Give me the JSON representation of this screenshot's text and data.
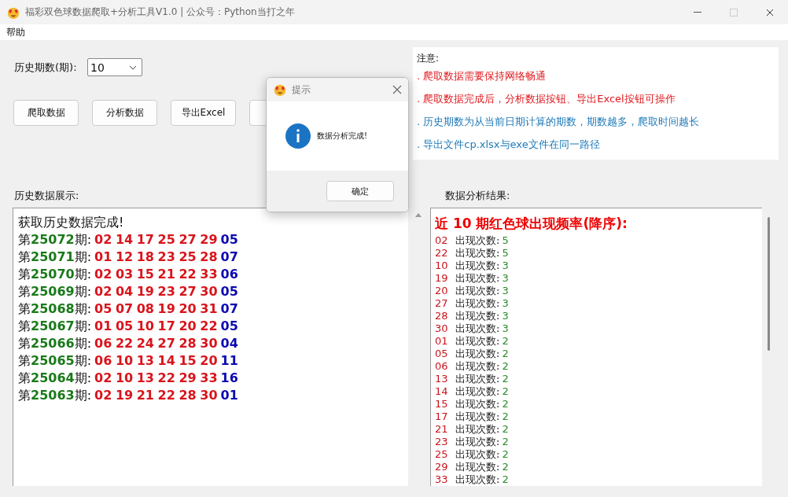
{
  "window": {
    "title": "福彩双色球数据爬取+分析工具V1.0 | 公众号：Python当打之年"
  },
  "menu": [
    "帮助"
  ],
  "period": {
    "label": "历史期数(期):",
    "value": "10"
  },
  "buttons": [
    "爬取数据",
    "分析数据",
    "导出Excel"
  ],
  "notes": {
    "title": "注意:",
    "items": [
      {
        "text": ". 爬取数据需要保持网络畅通",
        "color": "#e0191e"
      },
      {
        "text": ". 爬取数据完成后，分析数据按钮、导出Excel按钮可操作",
        "color": "#e0191e"
      },
      {
        "text": ". 历史期数为从当前日期计算的期数，期数越多，爬取时间越长",
        "color": "#1e7ab8"
      },
      {
        "text": ". 导出文件cp.xlsx与exe文件在同一路径",
        "color": "#1e7ab8"
      }
    ]
  },
  "history": {
    "label": "历史数据展示:",
    "status": "获取历史数据完成!",
    "draws": [
      {
        "prefix": "第",
        "issue": "25072",
        "suffix": "期:",
        "reds": "02 14 17 25 27 29",
        "blue": "05"
      },
      {
        "prefix": "第",
        "issue": "25071",
        "suffix": "期:",
        "reds": "01 12 18 23 25 28",
        "blue": "07"
      },
      {
        "prefix": "第",
        "issue": "25070",
        "suffix": "期:",
        "reds": "02 03 15 21 22 33",
        "blue": "06"
      },
      {
        "prefix": "第",
        "issue": "25069",
        "suffix": "期:",
        "reds": "02 04 19 23 27 30",
        "blue": "05"
      },
      {
        "prefix": "第",
        "issue": "25068",
        "suffix": "期:",
        "reds": "05 07 08 19 20 31",
        "blue": "07"
      },
      {
        "prefix": "第",
        "issue": "25067",
        "suffix": "期:",
        "reds": "01 05 10 17 20 22",
        "blue": "05"
      },
      {
        "prefix": "第",
        "issue": "25066",
        "suffix": "期:",
        "reds": "06 22 24 27 28 30",
        "blue": "04"
      },
      {
        "prefix": "第",
        "issue": "25065",
        "suffix": "期:",
        "reds": "06 10 13 14 15 20",
        "blue": "11"
      },
      {
        "prefix": "第",
        "issue": "25064",
        "suffix": "期:",
        "reds": "02 10 13 22 29 33",
        "blue": "16"
      },
      {
        "prefix": "第",
        "issue": "25063",
        "suffix": "期:",
        "reds": "02 19 21 22 28 30",
        "blue": "01"
      }
    ]
  },
  "analysis": {
    "label": "数据分析结果:",
    "heading": "近 10 期红色球出现频率(降序):",
    "rows": [
      {
        "number": "02",
        "label": "出现次数:",
        "count": "5"
      },
      {
        "number": "22",
        "label": "出现次数:",
        "count": "5"
      },
      {
        "number": "10",
        "label": "出现次数:",
        "count": "3"
      },
      {
        "number": "19",
        "label": "出现次数:",
        "count": "3"
      },
      {
        "number": "20",
        "label": "出现次数:",
        "count": "3"
      },
      {
        "number": "27",
        "label": "出现次数:",
        "count": "3"
      },
      {
        "number": "28",
        "label": "出现次数:",
        "count": "3"
      },
      {
        "number": "30",
        "label": "出现次数:",
        "count": "3"
      },
      {
        "number": "01",
        "label": "出现次数:",
        "count": "2"
      },
      {
        "number": "05",
        "label": "出现次数:",
        "count": "2"
      },
      {
        "number": "06",
        "label": "出现次数:",
        "count": "2"
      },
      {
        "number": "13",
        "label": "出现次数:",
        "count": "2"
      },
      {
        "number": "14",
        "label": "出现次数:",
        "count": "2"
      },
      {
        "number": "15",
        "label": "出现次数:",
        "count": "2"
      },
      {
        "number": "17",
        "label": "出现次数:",
        "count": "2"
      },
      {
        "number": "21",
        "label": "出现次数:",
        "count": "2"
      },
      {
        "number": "23",
        "label": "出现次数:",
        "count": "2"
      },
      {
        "number": "25",
        "label": "出现次数:",
        "count": "2"
      },
      {
        "number": "29",
        "label": "出现次数:",
        "count": "2"
      },
      {
        "number": "33",
        "label": "出现次数:",
        "count": "2"
      }
    ]
  },
  "dialog": {
    "title": "提示",
    "message": "数据分析完成!",
    "button": "确定"
  }
}
